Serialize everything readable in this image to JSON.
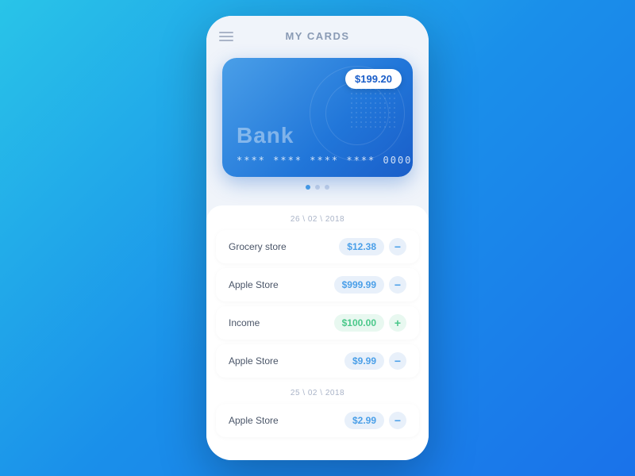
{
  "header": {
    "title": "MY CARDS",
    "menu_label": "menu"
  },
  "card": {
    "balance": "$199.20",
    "bank_name": "Bank",
    "card_number": "**** **** **** **** 0000"
  },
  "dots": [
    {
      "active": true
    },
    {
      "active": false
    },
    {
      "active": false
    }
  ],
  "transaction_groups": [
    {
      "date": "26 \\ 02 \\ 2018",
      "transactions": [
        {
          "name": "Grocery store",
          "amount": "$12.38",
          "type": "expense",
          "action": "minus",
          "action_symbol": "−"
        },
        {
          "name": "Apple Store",
          "amount": "$999.99",
          "type": "expense",
          "action": "minus",
          "action_symbol": "−"
        },
        {
          "name": "Income",
          "amount": "$100.00",
          "type": "income",
          "action": "plus",
          "action_symbol": "+"
        },
        {
          "name": "Apple Store",
          "amount": "$9.99",
          "type": "expense",
          "action": "minus",
          "action_symbol": "−"
        }
      ]
    },
    {
      "date": "25 \\ 02 \\ 2018",
      "transactions": [
        {
          "name": "Apple Store",
          "amount": "$2.99",
          "type": "expense",
          "action": "minus",
          "action_symbol": "−"
        }
      ]
    }
  ]
}
